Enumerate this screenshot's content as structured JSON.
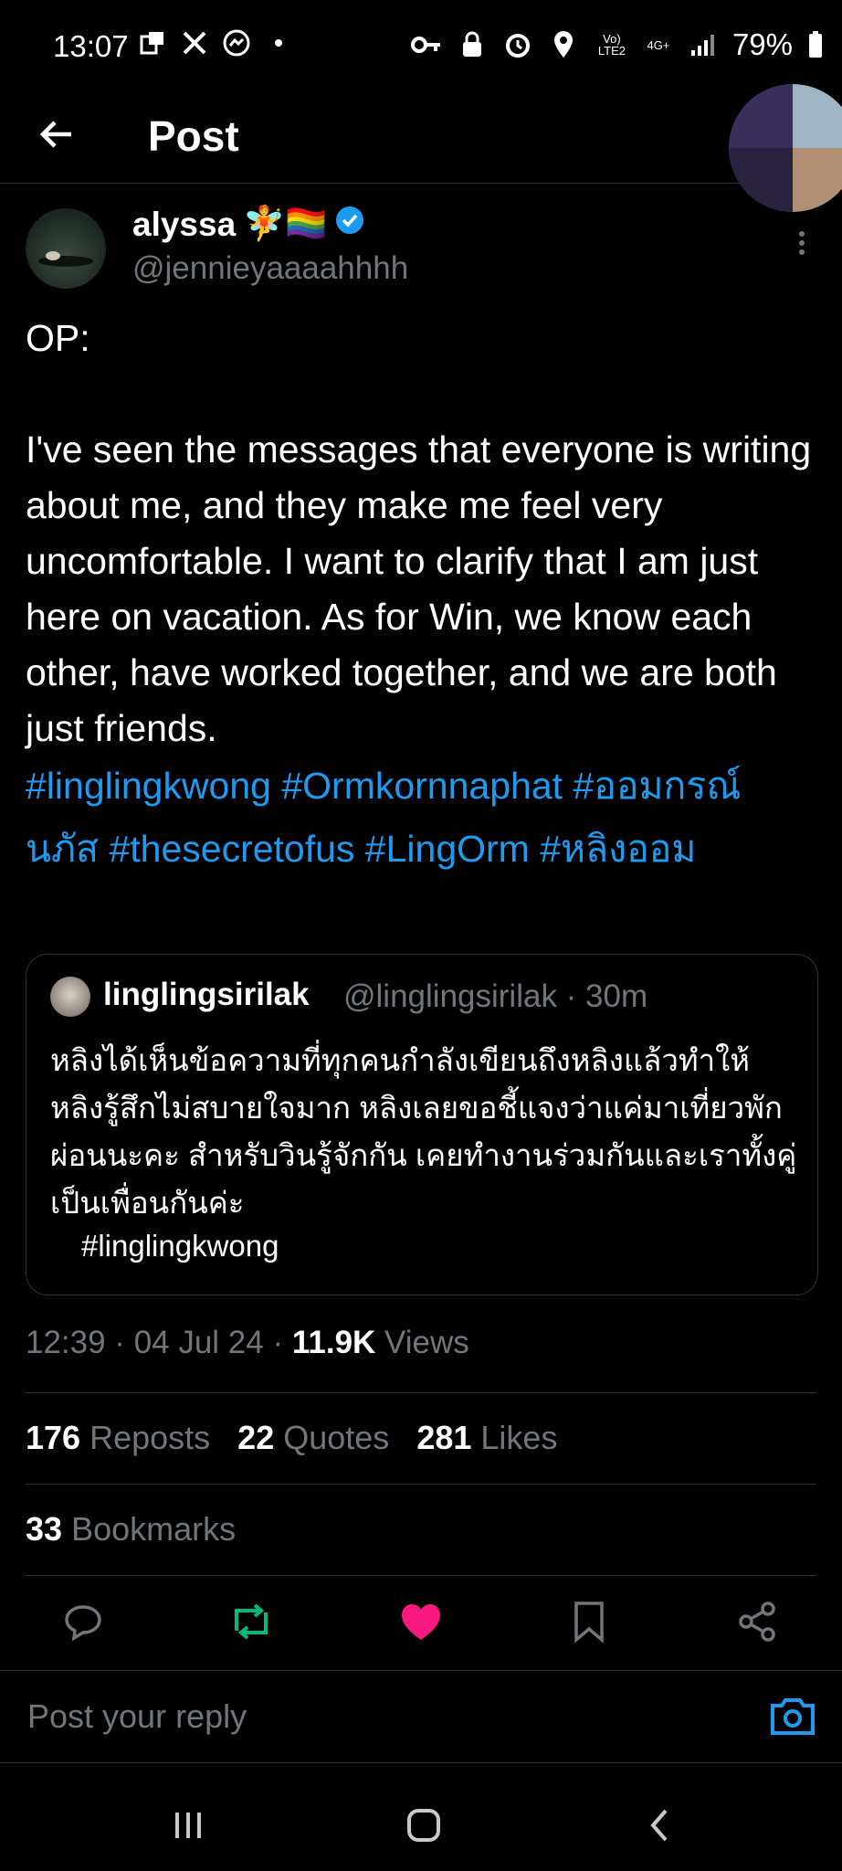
{
  "status_bar": {
    "time": "13:07",
    "battery": "79%",
    "left_icons": [
      "screenshot-icon",
      "x-icon",
      "messenger-icon",
      "dot-icon"
    ],
    "right_icons": [
      "key-icon",
      "lock-icon",
      "alarm-icon",
      "location-icon",
      "volte-icon",
      "network-4g-icon",
      "signal-icon",
      "battery-icon"
    ]
  },
  "header": {
    "title": "Post"
  },
  "tweet": {
    "author_name": "alyssa",
    "author_emoji": "🧚🏳️‍🌈",
    "author_handle": "@jennieyaaaahhhh",
    "body": "OP:\n\nI've seen the messages that everyone is writing about me, and they make me feel very uncomfortable. I want to clarify that I am just here on vacation. As for Win, we know each other, have worked together, and we are both just friends.",
    "hashtags": "#linglingkwong #Ormkornnaphat #ออมกรณ์นภัส #thesecretofus #LingOrm #หลิงออม",
    "quote": {
      "name": "linglingsirilak",
      "handle": "@linglingsirilak · 30m",
      "text": "หลิงได้เห็นข้อความที่ทุกคนกำลังเขียนถึงหลิงแล้วทำให้หลิงรู้สึกไม่สบายใจมาก หลิงเลยขอชี้แจงว่าแค่มาเที่ยวพักผ่อนนะคะ สำหรับวินรู้จักกัน เคยทำงานร่วมกันและเราทั้งคู่เป็นเพื่อนกันค่ะ",
      "hashtag": "#linglingkwong"
    },
    "meta": {
      "time_date": "12:39 · 04 Jul 24 · ",
      "views_count": "11.9K",
      "views_label": " Views"
    },
    "stats": {
      "reposts_count": "176",
      "reposts_label": "Reposts",
      "quotes_count": "22",
      "quotes_label": "Quotes",
      "likes_count": "281",
      "likes_label": "Likes",
      "bookmarks_count": "33",
      "bookmarks_label": "Bookmarks"
    }
  },
  "reply": {
    "placeholder": "Post your reply"
  },
  "colors": {
    "link": "#1d9bf0",
    "repost": "#00ba7c",
    "like": "#f91880",
    "muted": "#71767b"
  }
}
